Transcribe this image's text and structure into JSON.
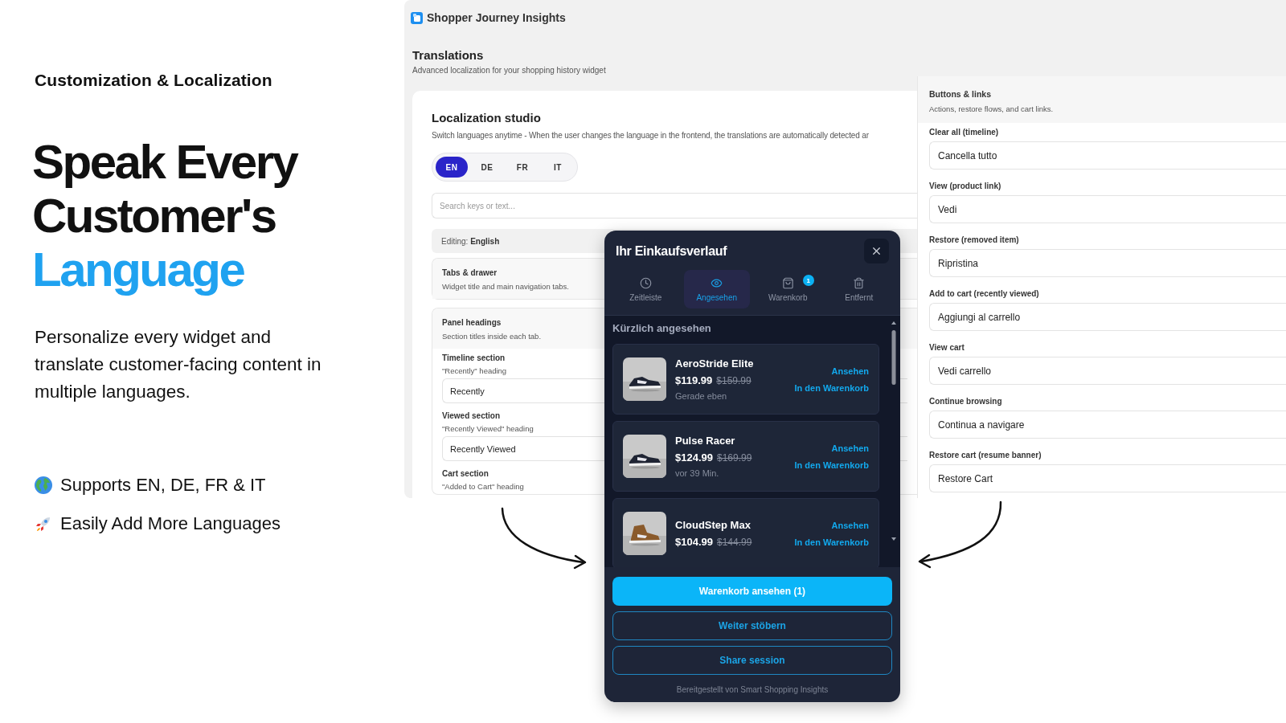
{
  "hero": {
    "eyebrow": "Customization & Localization",
    "title_lines": [
      "Speak Every",
      "Customer's"
    ],
    "title_highlight": "Language",
    "description": "Personalize every widget and translate customer-facing content in multiple languages.",
    "features": [
      {
        "text": "Supports EN, DE, FR & IT"
      },
      {
        "text": "Easily Add More Languages"
      }
    ]
  },
  "app": {
    "title": "Shopper Journey Insights",
    "page_title": "Translations",
    "page_subtitle": "Advanced localization for your shopping history widget",
    "studio": {
      "title": "Localization studio",
      "subtitle": "Switch languages anytime - When the user changes the language in the frontend, the translations are automatically detected ar",
      "languages": [
        {
          "label": "EN",
          "selected": true
        },
        {
          "label": "DE",
          "selected": false
        },
        {
          "label": "FR",
          "selected": false
        },
        {
          "label": "IT",
          "selected": false
        }
      ],
      "search_placeholder": "Search keys or text...",
      "editing": "Editing: **English**",
      "groups": [
        {
          "title": "Tabs & drawer",
          "subtitle": "Widget title and main navigation tabs."
        },
        {
          "title": "Panel headings",
          "subtitle": "Section titles inside each tab.",
          "fields": [
            {
              "label": "Timeline section",
              "hint": "\"Recently\" heading",
              "value": "Recently"
            },
            {
              "label": "Viewed section",
              "hint": "\"Recently Viewed\" heading",
              "value": "Recently Viewed"
            },
            {
              "label": "Cart section",
              "hint": "\"Added to Cart\" heading"
            }
          ]
        }
      ]
    },
    "side_panel": {
      "title": "Buttons & links",
      "subtitle": "Actions, restore flows, and cart links.",
      "fields": [
        {
          "label": "Clear all (timeline)",
          "value": "Cancella tutto"
        },
        {
          "label": "View (product link)",
          "value": "Vedi"
        },
        {
          "label": "Restore (removed item)",
          "value": "Ripristina"
        },
        {
          "label": "Add to cart (recently viewed)",
          "value": "Aggiungi al carrello"
        },
        {
          "label": "View cart",
          "value": "Vedi carrello"
        },
        {
          "label": "Continue browsing",
          "value": "Continua a navigare"
        },
        {
          "label": "Restore cart (resume banner)",
          "value": "Restore Cart"
        }
      ]
    }
  },
  "widget": {
    "title": "Ihr Einkaufsverlauf",
    "tabs": [
      {
        "label": "Zeitleiste",
        "selected": false
      },
      {
        "label": "Angesehen",
        "selected": true
      },
      {
        "label": "Warenkorb",
        "selected": false,
        "badge": "1"
      },
      {
        "label": "Entfernt",
        "selected": false
      }
    ],
    "section_title": "Kürzlich angesehen",
    "products": [
      {
        "name": "AeroStride Elite",
        "price": "$119.99",
        "old_price": "$159.99",
        "time": "Gerade eben",
        "view_label": "Ansehen",
        "cart_label": "In den Warenkorb"
      },
      {
        "name": "Pulse Racer",
        "price": "$124.99",
        "old_price": "$169.99",
        "time": "vor 39 Min.",
        "view_label": "Ansehen",
        "cart_label": "In den Warenkorb"
      },
      {
        "name": "CloudStep Max",
        "price": "$104.99",
        "old_price": "$144.99",
        "view_label": "Ansehen",
        "cart_label": "In den Warenkorb"
      }
    ],
    "buttons": [
      {
        "label": "Warenkorb ansehen (1)",
        "kind": "primary"
      },
      {
        "label": "Weiter stöbern",
        "kind": "outline"
      },
      {
        "label": "Share session",
        "kind": "outline"
      }
    ],
    "footer": "Bereitgestellt von Smart Shopping Insights"
  }
}
